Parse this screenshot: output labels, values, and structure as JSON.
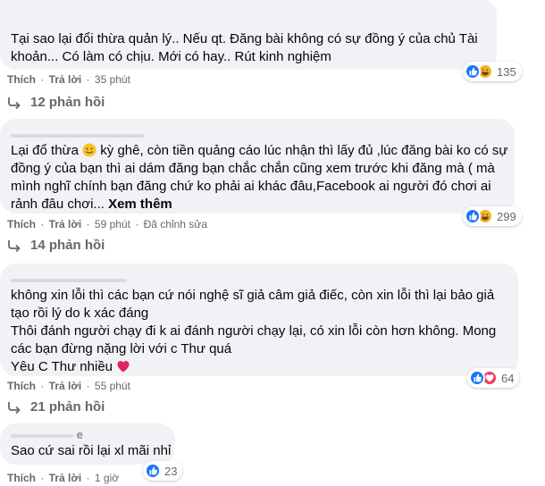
{
  "comments": [
    {
      "lines": [
        "Tại sao lại đổi thừa quản lý.. Nếu qt. Đăng bài không có sự đồng ý của chủ Tài",
        "khoản... Có làm có chịu. Mới có hay.. Rút kinh nghiệm"
      ],
      "like_label": "Thích",
      "reply_label": "Trả lời",
      "time": "35 phút",
      "reaction_count": "135",
      "replies_label": "12 phản hồi"
    },
    {
      "line1_before_emoji": "Lại đổ thừa",
      "line1_after_emoji": "kỳ ghê, còn tiền quảng cáo lúc nhận thì lấy đủ ,lúc đăng bài ko có sự",
      "lines": [
        "đồng ý của bạn thì ai dám đăng bạn chắc chắn cũng xem trước khi đăng mà ( mà",
        "mình nghĩ chính bạn đăng chứ ko phải ai khác đâu,Facebook ai người đó chơi ai"
      ],
      "last_line": "rảnh đâu chơi...",
      "see_more": "Xem thêm",
      "like_label": "Thích",
      "reply_label": "Trả lời",
      "time": "59 phút",
      "edited": "Đã chỉnh sửa",
      "reaction_count": "299",
      "replies_label": "14 phản hồi"
    },
    {
      "lines": [
        "không xin lỗi thì các bạn cứ nói nghệ sĩ giả câm giả điếc, còn xin lỗi thì lại bảo giả",
        "tạo rồi lý do k xác đáng",
        "Thôi đánh người chạy đi k ai đánh người chạy lại, có xin lỗi còn hơn không. Mong",
        "các bạn đừng nặng lời với c Thư quá"
      ],
      "last_line": "Yêu C Thư nhiều",
      "like_label": "Thích",
      "reply_label": "Trả lời",
      "time": "55 phút",
      "reaction_count": "64",
      "replies_label": "21 phản hồi"
    },
    {
      "author_partial": "e",
      "lines": [
        "Sao cứ sai rồi lại xl mãi nhỉ"
      ],
      "like_label": "Thích",
      "reply_label": "Trả lời",
      "time": "1 giờ",
      "reaction_count": "23"
    }
  ],
  "colors": {
    "bubble": "#f0f2f5",
    "like_blue": "#1877f2",
    "haha_yellow": "#f7b125",
    "love_red": "#f33e58",
    "meta_gray": "#65676b"
  }
}
